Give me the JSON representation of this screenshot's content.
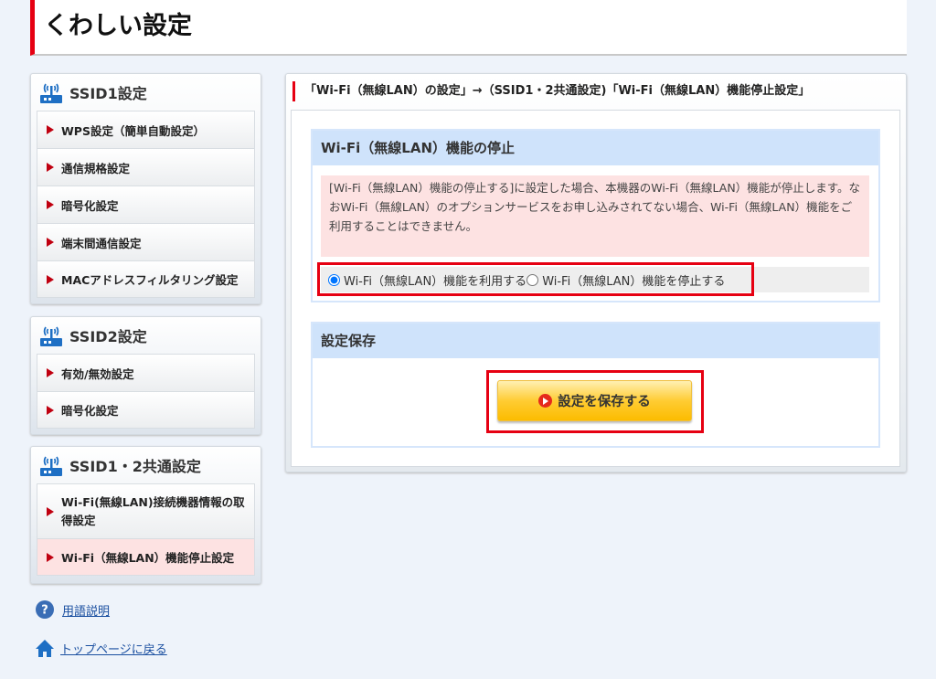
{
  "header": {
    "title": "くわしい設定"
  },
  "sidebar": {
    "groups": [
      {
        "title": "SSID1設定",
        "items": [
          "WPS設定（簡単自動設定）",
          "通信規格設定",
          "暗号化設定",
          "端末間通信設定",
          "MACアドレスフィルタリング設定"
        ]
      },
      {
        "title": "SSID2設定",
        "items": [
          "有効/無効設定",
          "暗号化設定"
        ]
      },
      {
        "title": "SSID1・2共通設定",
        "items": [
          "Wi-Fi(無線LAN)接続機器情報の取得設定",
          "Wi-Fi（無線LAN）機能停止設定"
        ]
      }
    ],
    "help_link": "用語説明",
    "top_link": "トップページに戻る"
  },
  "main": {
    "breadcrumb": "「Wi-Fi（無線LAN）の設定」→（SSID1・2共通設定)「Wi-Fi（無線LAN）機能停止設定」",
    "section1": {
      "title": "Wi-Fi（無線LAN）機能の停止",
      "note": "[Wi-Fi（無線LAN）機能の停止する]に設定した場合、本機器のWi-Fi（無線LAN）機能が停止します。なおWi-Fi（無線LAN）のオプションサービスをお申し込みされてない場合、Wi-Fi（無線LAN）機能をご利用することはできません。",
      "option_enable": "Wi-Fi（無線LAN）機能を利用する",
      "option_disable": "Wi-Fi（無線LAN）機能を停止する",
      "selected": "enable"
    },
    "section2": {
      "title": "設定保存",
      "save_button": "設定を保存する"
    }
  },
  "colors": {
    "accent": "#e60012",
    "section_header": "#cfe3fb",
    "note_bg": "#fde2e2"
  }
}
